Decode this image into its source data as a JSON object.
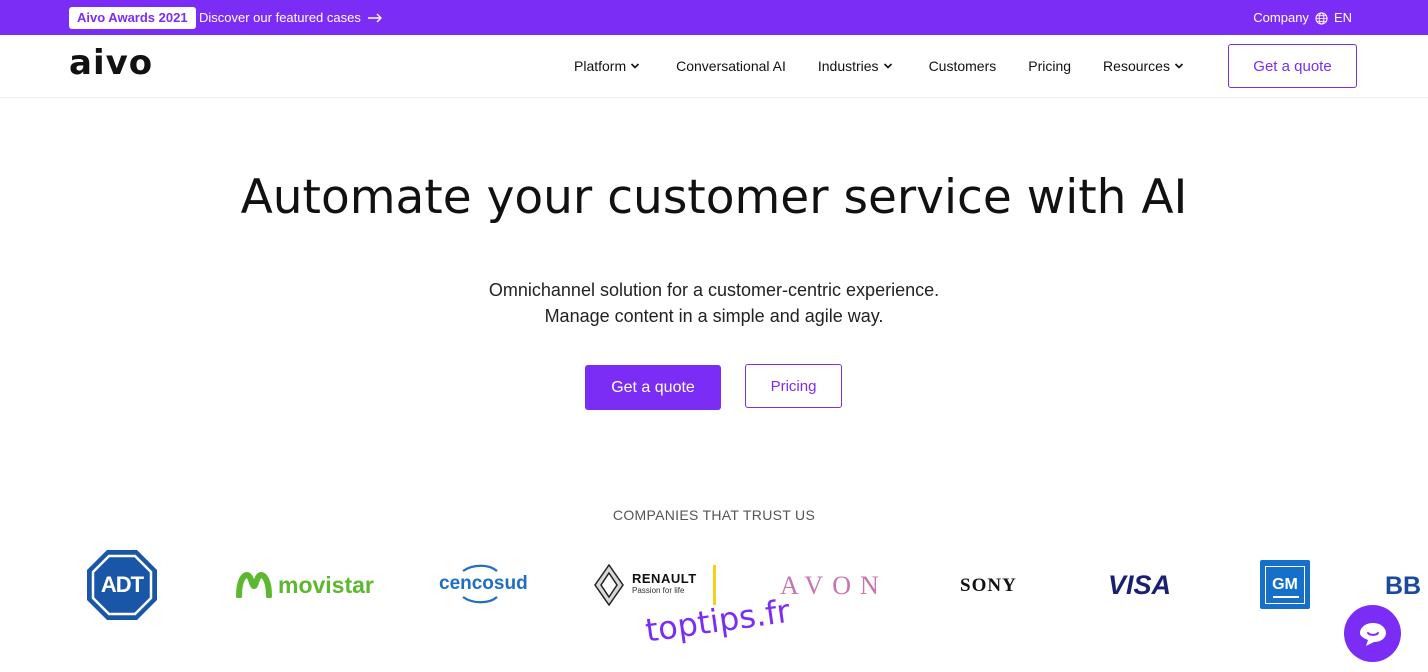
{
  "promo": {
    "badge": "Aivo Awards 2021",
    "link": "Discover our featured cases",
    "company": "Company",
    "language": "EN"
  },
  "nav": {
    "logo": "aivo",
    "items": [
      {
        "label": "Platform",
        "has_dropdown": true
      },
      {
        "label": "Conversational AI",
        "has_dropdown": false
      },
      {
        "label": "Industries",
        "has_dropdown": true
      },
      {
        "label": "Customers",
        "has_dropdown": false
      },
      {
        "label": "Pricing",
        "has_dropdown": false
      },
      {
        "label": "Resources",
        "has_dropdown": true
      }
    ],
    "cta": "Get a quote"
  },
  "hero": {
    "title": "Automate your customer service with AI",
    "subtitle_line1": "Omnichannel solution for a customer-centric experience.",
    "subtitle_line2": "Manage content in a simple and agile way.",
    "primary_button": "Get a quote",
    "secondary_button": "Pricing"
  },
  "trust": {
    "heading": "COMPANIES THAT TRUST US",
    "logos": {
      "adt": "ADT",
      "movistar": "movistar",
      "cencosud": "cencosud",
      "renault": "RENAULT",
      "renault_tagline": "Passion for life",
      "avon": "AVON",
      "sony": "SONY",
      "visa": "VISA",
      "gm": "GM",
      "bbva": "BB"
    }
  },
  "watermark": "toptips.fr",
  "colors": {
    "brand": "#7b2cf5",
    "movistar": "#5cb82e",
    "adt": "#1a56a8",
    "visa": "#1a1f71",
    "gm": "#1670c9",
    "avon": "#c774b0"
  }
}
